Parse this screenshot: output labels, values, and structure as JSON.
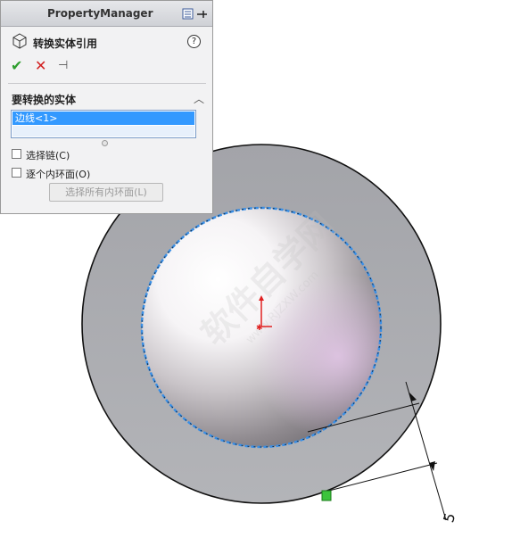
{
  "panel": {
    "title": "PropertyManager",
    "feature_title": "转换实体引用",
    "help_glyph": "?",
    "ok_glyph": "✔",
    "cancel_glyph": "✕",
    "pin_glyph": "⊣",
    "group_label": "要转换的实体",
    "collapse_glyph": "︿",
    "selection_items": [
      "边线<1>"
    ],
    "checkbox_chain": "选择链(C)",
    "checkbox_inner_loops": "逐个内环面(O)",
    "select_all_loops_button": "选择所有内环面(L)",
    "colors": {
      "ok": "#2e9e2e",
      "cancel": "#d22020",
      "selection": "#3399ff"
    }
  },
  "viewport": {
    "dimension_value": "5",
    "watermark_main": "软件自学网",
    "watermark_url": "www.RJZXW.com",
    "colors": {
      "outer_face": "#a8a9ae",
      "selected_edge": "#3a8fe6",
      "origin": "#e02020"
    }
  }
}
